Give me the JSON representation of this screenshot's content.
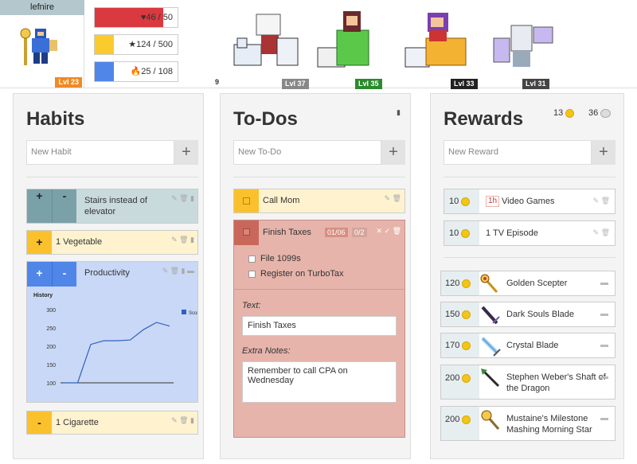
{
  "header": {
    "username": "lefnire",
    "user_level": "Lvl 23",
    "stats": {
      "health": {
        "label": "♥46 / 50",
        "value": 46,
        "max": 50,
        "color": "#d9393f"
      },
      "experience": {
        "label": "★124 / 500",
        "value": 124,
        "max": 500,
        "color": "#fbcb2d"
      },
      "mana": {
        "label": "🔥25 / 108",
        "value": 25,
        "max": 108,
        "color": "#4f86e8"
      }
    },
    "party_count": "9",
    "party": [
      {
        "level": "Lvl 37",
        "badge_color": "#888888"
      },
      {
        "level": "Lvl 35",
        "badge_color": "#2c8a2c"
      },
      {
        "level": "Lvl 33",
        "badge_color": "#222222"
      },
      {
        "level": "Lvl 31",
        "badge_color": "#444444"
      }
    ]
  },
  "habits": {
    "title": "Habits",
    "new_placeholder": "New Habit",
    "add_label": "+",
    "items": [
      {
        "text": "Stairs instead of elevator",
        "plus": "+",
        "minus": "-"
      },
      {
        "text": "1 Vegetable",
        "plus": "+"
      },
      {
        "text": "Productivity",
        "plus": "+",
        "minus": "-"
      },
      {
        "text": "1 Cigarette",
        "minus": "-"
      }
    ],
    "history": {
      "title": "History",
      "legend": "Score"
    }
  },
  "chart_data": {
    "type": "line",
    "title": "History",
    "series": [
      {
        "name": "Score",
        "values": [
          100,
          100,
          205,
          215,
          215,
          217,
          245,
          265,
          255
        ]
      }
    ],
    "y_ticks": [
      100,
      150,
      200,
      250,
      300
    ],
    "ylim": [
      100,
      300
    ],
    "legend": "right",
    "grid": false
  },
  "todos": {
    "title": "To-Dos",
    "new_placeholder": "New To-Do",
    "add_label": "+",
    "items": [
      {
        "text": "Call Mom"
      },
      {
        "text": "Finish Taxes",
        "date": "01/06",
        "checklist_progress": "0/2"
      }
    ],
    "checklist": [
      {
        "text": "File 1099s"
      },
      {
        "text": "Register on TurboTax"
      }
    ],
    "edit": {
      "text_label": "Text:",
      "text_value": "Finish Taxes",
      "notes_label": "Extra Notes:",
      "notes_value": "Remember to call CPA on Wednesday"
    }
  },
  "rewards": {
    "title": "Rewards",
    "gold": "13",
    "silver": "36",
    "new_placeholder": "New Reward",
    "add_label": "+",
    "custom": [
      {
        "cost": "10",
        "tag": "1h",
        "text": "Video Games"
      },
      {
        "cost": "10",
        "text": "1 TV Episode"
      }
    ],
    "items": [
      {
        "cost": "120",
        "text": "Golden Scepter",
        "icon": "golden-scepter-icon"
      },
      {
        "cost": "150",
        "text": "Dark Souls Blade",
        "icon": "dark-souls-blade-icon"
      },
      {
        "cost": "170",
        "text": "Crystal Blade",
        "icon": "crystal-blade-icon"
      },
      {
        "cost": "200",
        "text": "Stephen Weber's Shaft of the Dragon",
        "icon": "shaft-of-the-dragon-icon"
      },
      {
        "cost": "200",
        "text": "Mustaine's Milestone Mashing Morning Star",
        "icon": "morning-star-icon"
      }
    ]
  },
  "colors": {
    "habit_teal": "#b9cfd3",
    "habit_yellow": "#ffefbf",
    "habit_blue": "#c5d4f4",
    "todo_red": "#e6b4ab"
  }
}
